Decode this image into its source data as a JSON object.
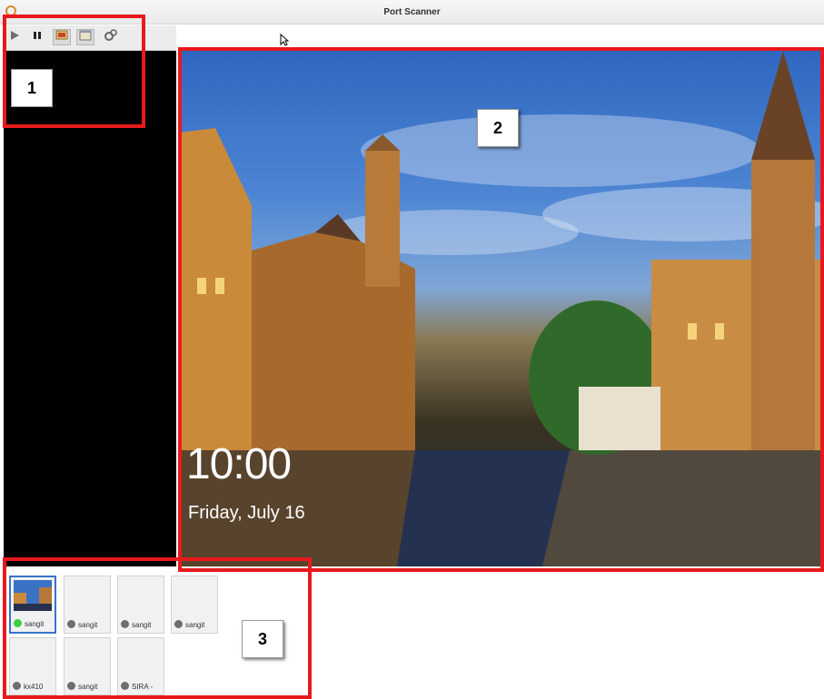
{
  "window": {
    "title": "Port Scanner"
  },
  "toolbar": {
    "buttons": [
      {
        "icon": "play-icon"
      },
      {
        "icon": "pause-icon"
      },
      {
        "icon": "screen-view-icon"
      },
      {
        "icon": "window-view-icon"
      },
      {
        "icon": "settings-icon"
      }
    ]
  },
  "lockscreen": {
    "time": "10:00",
    "date": "Friday, July 16"
  },
  "thumbnails": [
    {
      "label": "sangit",
      "status": "online"
    },
    {
      "label": "sangit",
      "status": "offline"
    },
    {
      "label": "sangit",
      "status": "offline"
    },
    {
      "label": "sangit",
      "status": "offline"
    },
    {
      "label": "kx410",
      "status": "offline"
    },
    {
      "label": "sangit",
      "status": "offline"
    },
    {
      "label": "SIRA -",
      "status": "offline"
    }
  ],
  "callouts": [
    "1",
    "2",
    "3"
  ],
  "colors": {
    "callout": "#e8191c",
    "online": "#3bd13b",
    "offline": "#6e6e6e",
    "selected": "#3a73c9"
  }
}
